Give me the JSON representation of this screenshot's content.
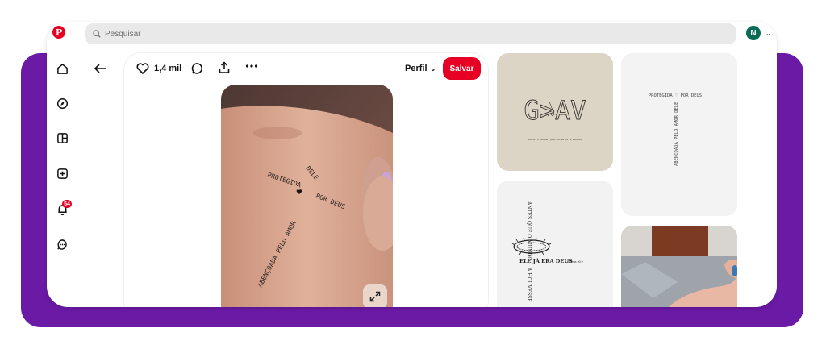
{
  "search": {
    "placeholder": "Pesquisar"
  },
  "user": {
    "avatar_initial": "N"
  },
  "sidebar": {
    "notifications_count": "54"
  },
  "pin": {
    "like_count": "1,4 mil",
    "profile_label": "Perfil",
    "save_label": "Salvar",
    "tattoo_text": {
      "protegida": "PROTEGIDA",
      "dele": "DELE",
      "por_deus": "POR DEUS",
      "amor": "ABENÇOADA PELO AMOR"
    }
  },
  "related": {
    "gav": {
      "title": "G>AV",
      "caption": "DEUS · É MAIOR · QUE OS ALTOS · E BAIXOS"
    },
    "cross_text": {
      "horizontal": "PROTEGIDA ♡ POR DEUS",
      "vertical": "ABENÇOADA PELO AMOR DELE"
    },
    "crown": {
      "vertical_top": "ANTES QUE O MUNDO",
      "horizontal": "ELE JÁ ERA DEUS",
      "ref": "Salmos 90:2",
      "vertical_bottom": "A HOUVESSE"
    }
  },
  "colors": {
    "brand": "#e60023",
    "frame": "#6b1aa6",
    "avatar": "#0b6b57"
  }
}
